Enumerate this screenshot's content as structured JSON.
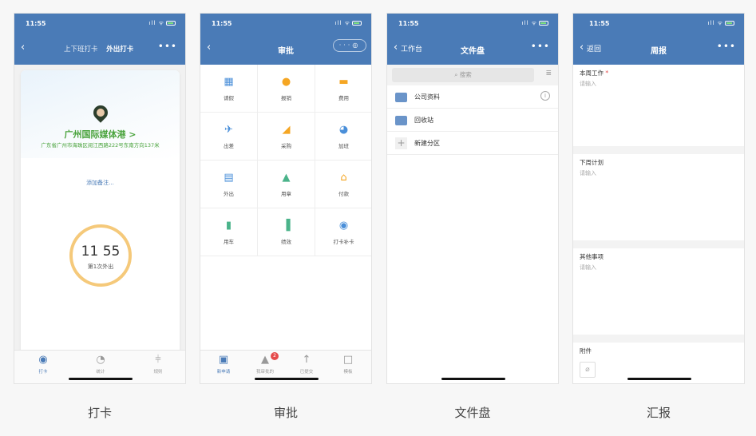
{
  "status_time": "11:55",
  "status_icons": "ıll ᯤ",
  "phones": [
    {
      "tabs": [
        "上下班打卡",
        "外出打卡"
      ],
      "place": "广州国际媒体港 >",
      "address": "广东省广州市海珠区阅江西路222号东南方向137米",
      "note": "添加备注...",
      "clock_time": "11 55",
      "clock_sub": "第1次外出",
      "tabbar": [
        {
          "label": "打卡",
          "icon": "location-pin-icon"
        },
        {
          "label": "统计",
          "icon": "pie-chart-icon"
        },
        {
          "label": "规则",
          "icon": "sliders-icon"
        }
      ],
      "caption": "打卡"
    },
    {
      "title": "审批",
      "capsule": "···",
      "items": [
        {
          "label": "请假",
          "color": "#4a8fd9",
          "icon": "calendar-icon"
        },
        {
          "label": "报销",
          "color": "#f5a623",
          "icon": "coin-icon"
        },
        {
          "label": "费用",
          "color": "#f5a623",
          "icon": "wallet-icon"
        },
        {
          "label": "出差",
          "color": "#4a8fd9",
          "icon": "plane-icon"
        },
        {
          "label": "采购",
          "color": "#f5a623",
          "icon": "cart-icon"
        },
        {
          "label": "加班",
          "color": "#4a8fd9",
          "icon": "person-clock-icon"
        },
        {
          "label": "外出",
          "color": "#4a8fd9",
          "icon": "briefcase-icon"
        },
        {
          "label": "用章",
          "color": "#4ab38a",
          "icon": "stamp-icon"
        },
        {
          "label": "付款",
          "color": "#f5a623",
          "icon": "house-coin-icon"
        },
        {
          "label": "用车",
          "color": "#4ab38a",
          "icon": "car-icon"
        },
        {
          "label": "绩效",
          "color": "#4ab38a",
          "icon": "bar-chart-icon"
        },
        {
          "label": "打卡补卡",
          "color": "#4a8fd9",
          "icon": "location-pin-icon"
        }
      ],
      "tabbar": [
        {
          "label": "新申请",
          "icon": "new-doc-icon"
        },
        {
          "label": "我审批的",
          "icon": "approve-icon",
          "badge": "2"
        },
        {
          "label": "已提交",
          "icon": "submitted-icon"
        },
        {
          "label": "模板",
          "icon": "template-icon"
        }
      ],
      "caption": "审批"
    },
    {
      "back": "工作台",
      "title": "文件盘",
      "search": "搜索",
      "folders": [
        "公司资料",
        "回收站"
      ],
      "new_partition": "新建分区",
      "caption": "文件盘"
    },
    {
      "back": "返回",
      "title": "周报",
      "sections": [
        {
          "title": "本周工作",
          "required": "*",
          "placeholder": "请输入"
        },
        {
          "title": "下周计划",
          "placeholder": "请输入"
        },
        {
          "title": "其他事项",
          "placeholder": "请输入"
        }
      ],
      "attachment": "附件",
      "caption": "汇报"
    }
  ]
}
